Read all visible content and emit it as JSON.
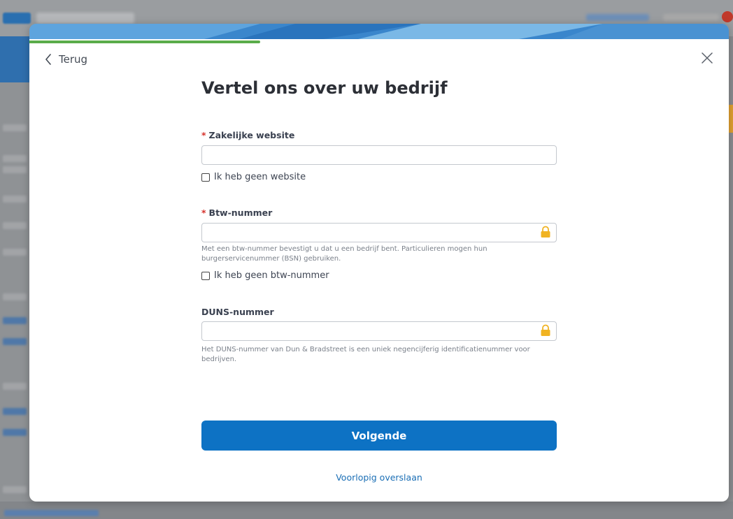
{
  "progress": {
    "fraction": 0.33,
    "color": "#5aac4a"
  },
  "nav": {
    "back_label": "Terug"
  },
  "title": "Vertel ons over uw bedrijf",
  "fields": {
    "website": {
      "required_mark": "*",
      "label": "Zakelijke website",
      "value": "",
      "checkbox_label": "Ik heb geen website"
    },
    "vat": {
      "required_mark": "*",
      "label": "Btw-nummer",
      "value": "",
      "help": "Met een btw-nummer bevestigt u dat u een bedrijf bent. Particulieren mogen hun burgerservicenummer (BSN) gebruiken.",
      "checkbox_label": "Ik heb geen btw-nummer"
    },
    "duns": {
      "label": "DUNS-nummer",
      "value": "",
      "help": "Het DUNS-nummer van Dun & Bradstreet is een uniek negencijferig identificatienummer voor bedrijven."
    }
  },
  "actions": {
    "next_label": "Volgende",
    "skip_label": "Voorlopig overslaan"
  },
  "colors": {
    "primary": "#0d72c4",
    "link": "#1a6eb5",
    "required": "#d6312b",
    "lock": "#f0b322"
  },
  "icons": {
    "back": "chevron-left-icon",
    "close": "close-icon",
    "lock": "lock-icon"
  }
}
